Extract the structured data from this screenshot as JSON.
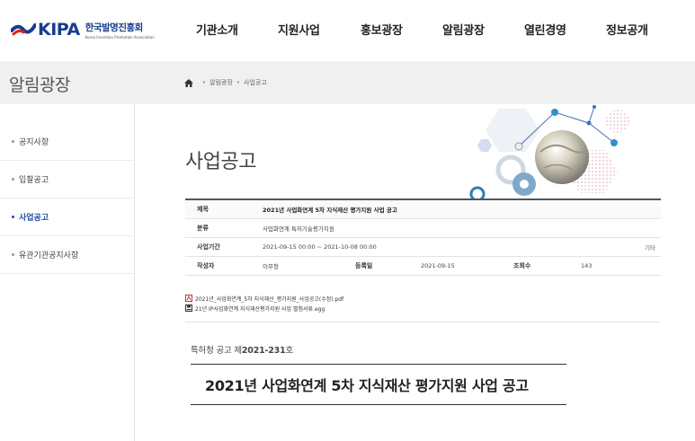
{
  "header": {
    "logo": {
      "brand": "KIPA",
      "korean": "한국발명진흥회",
      "english": "Korea Invention Promotion Association"
    },
    "nav": [
      "기관소개",
      "지원사업",
      "홍보광장",
      "알림광장",
      "열린경영",
      "정보공개"
    ]
  },
  "subbar": {
    "title": "알림광장",
    "breadcrumb": [
      "알림광장",
      "사업공고"
    ]
  },
  "sidebar": {
    "items": [
      {
        "label": "공지사항",
        "active": false
      },
      {
        "label": "입찰공고",
        "active": false
      },
      {
        "label": "사업공고",
        "active": true
      },
      {
        "label": "유관기관공지사항",
        "active": false
      }
    ]
  },
  "page": {
    "title": "사업공고"
  },
  "board": {
    "title_label": "제목",
    "title_value": "2021년 사업화연계 5차 지식재산 평가지원 사업 공고",
    "category_label": "분류",
    "category_value": "사업화연계 특허기술평가지원",
    "period_label": "사업기간",
    "period_value": "2021-09-15 00:00 ~ 2021-10-08 00:00",
    "period_extra": "기타",
    "author_label": "작성자",
    "author_value": "이무형",
    "date_label": "등록일",
    "date_value": "2021-09-15",
    "views_label": "조회수",
    "views_value": "143"
  },
  "files": [
    {
      "name": "2021년_사업화연계_5차 지식재산_평가지원_사업공고(수정).pdf",
      "icon": "pdf-icon"
    },
    {
      "name": "21년 IP사업화연계 지식재산평가지원 사업 별첨서류.egg",
      "icon": "archive-icon"
    }
  ],
  "content": {
    "notice_prefix": "특허청 공고 제",
    "notice_number": "2021-231",
    "notice_suffix": "호",
    "doc_title": "2021년 사업화연계 5차 지식재산 평가지원 사업 공고"
  },
  "colors": {
    "brand": "#1a3c8c",
    "active": "#1f4fa3"
  }
}
